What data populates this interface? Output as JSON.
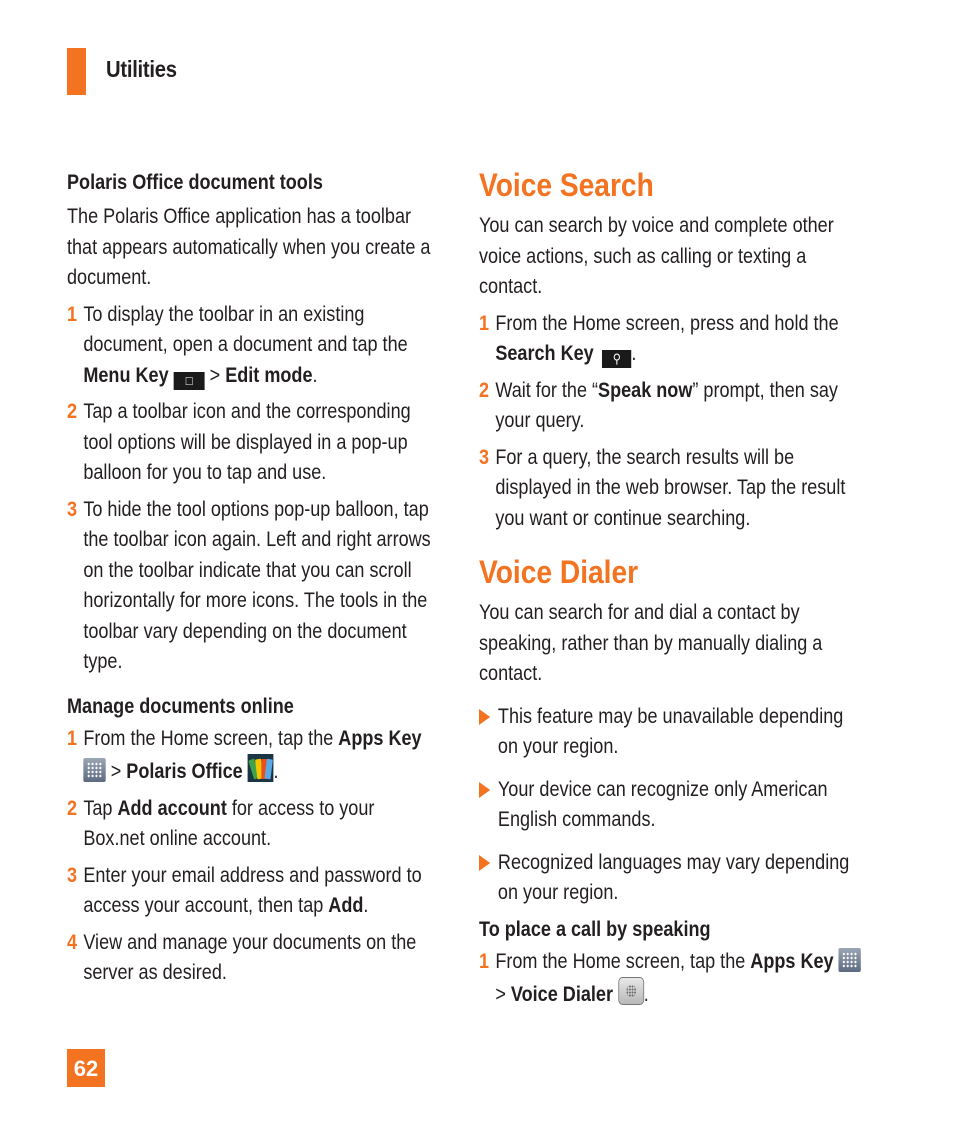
{
  "header": {
    "section_title": "Utilities",
    "accent_color": "#f37321"
  },
  "left": {
    "polaris_tools": {
      "title": "Polaris Office document tools",
      "intro": "The Polaris Office application has a toolbar that appears automatically when you create a document.",
      "steps": [
        {
          "num": "1",
          "text_a": "To display the toolbar in an existing document, open a document and tap the ",
          "bold_a": "Menu Key",
          "sep": " > ",
          "bold_b": "Edit mode",
          "end": "."
        },
        {
          "num": "2",
          "text": "Tap a toolbar icon and the corresponding tool options will be displayed in a pop-up balloon for you to tap and use."
        },
        {
          "num": "3",
          "text": "To hide the tool options pop-up balloon, tap the toolbar icon again. Left and right arrows on the toolbar indicate that you can scroll horizontally for more icons. The tools in the toolbar vary depending on the document type."
        }
      ]
    },
    "manage_online": {
      "title": "Manage documents online",
      "steps": [
        {
          "num": "1",
          "text_a": "From the Home screen, tap the ",
          "bold_a": "Apps Key",
          "sep": " > ",
          "bold_b": "Polaris Office",
          "end": "."
        },
        {
          "num": "2",
          "text_a": "Tap ",
          "bold_a": "Add account",
          "text_b": " for access to your Box.net online account."
        },
        {
          "num": "3",
          "text_a": "Enter your email address and password to access your account, then tap ",
          "bold_a": "Add",
          "end": "."
        },
        {
          "num": "4",
          "text": "View and manage your documents on the server as desired."
        }
      ]
    }
  },
  "right": {
    "voice_search": {
      "title": "Voice Search",
      "intro": "You can search by voice and complete other voice actions, such as calling or texting a contact.",
      "steps": [
        {
          "num": "1",
          "text_a": "From the Home screen, press and hold the ",
          "bold_a": "Search Key",
          "end": "."
        },
        {
          "num": "2",
          "text_a": "Wait for the “",
          "bold_a": "Speak now",
          "text_b": "” prompt, then say your query."
        },
        {
          "num": "3",
          "text": "For a query, the search results will be displayed in the web browser. Tap the result you want or continue searching."
        }
      ]
    },
    "voice_dialer": {
      "title": "Voice Dialer",
      "intro": "You can search for and dial a contact by speaking, rather than by manually dialing a contact.",
      "notes": [
        "This feature may be unavailable depending on your region.",
        "Your device can recognize only American English commands.",
        "Recognized languages may vary depending on your region."
      ],
      "call_title": "To place a call by speaking",
      "steps": [
        {
          "num": "1",
          "text_a": "From the Home screen, tap the ",
          "bold_a": "Apps Key",
          "sep": " > ",
          "bold_b": "Voice Dialer",
          "end": "."
        }
      ]
    }
  },
  "footer": {
    "page_number": "62"
  }
}
